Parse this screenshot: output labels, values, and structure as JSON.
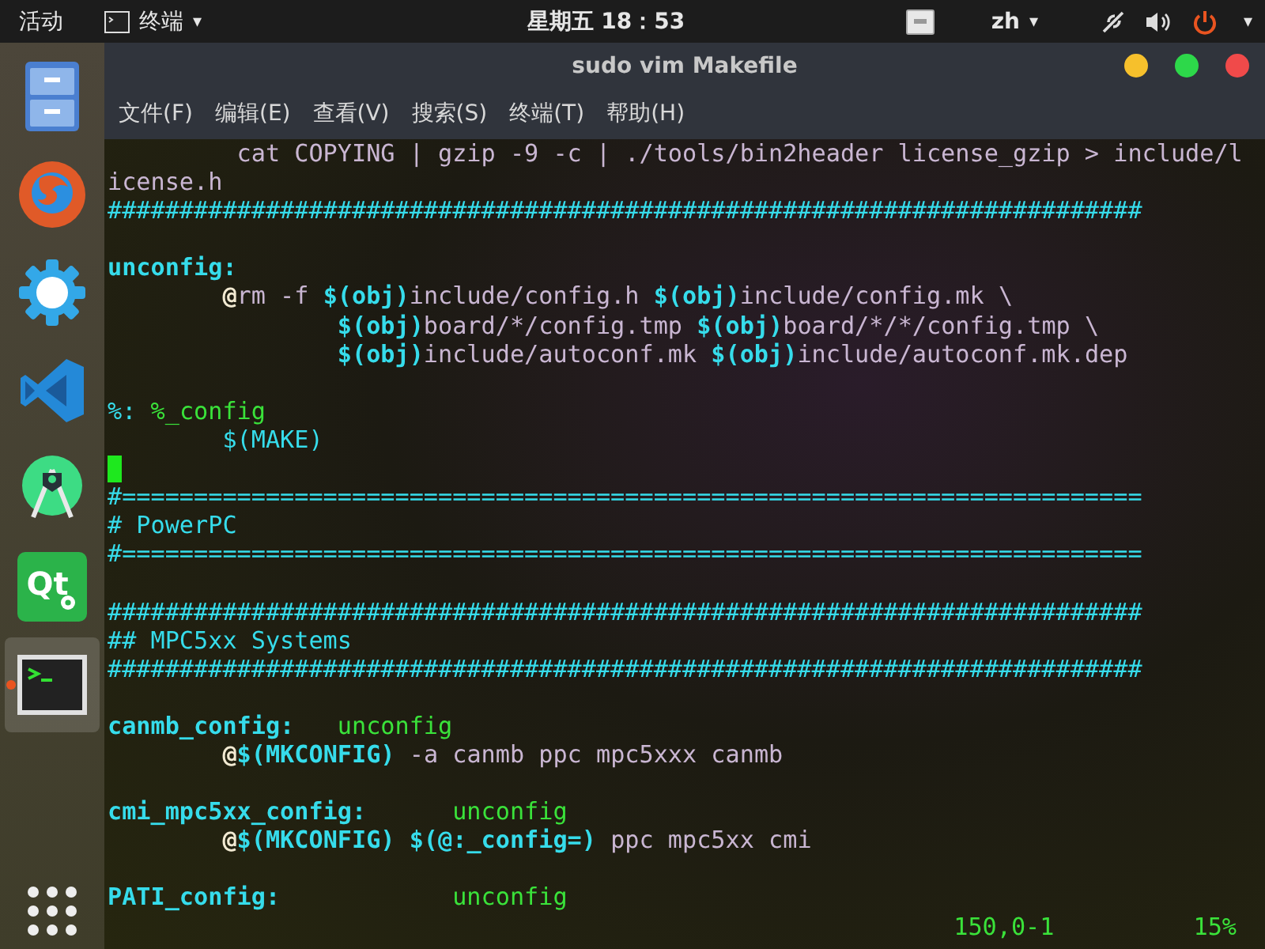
{
  "top_bar": {
    "activities": "活动",
    "app_menu": {
      "label": "终端",
      "caret": "▾"
    },
    "clock": "星期五 18：53",
    "input_method": {
      "label": "zh",
      "caret": "▾"
    },
    "system_caret": "▾"
  },
  "dock": {
    "items": [
      {
        "kind": "files",
        "selected": false,
        "running": false
      },
      {
        "kind": "browser",
        "selected": false,
        "running": false
      },
      {
        "kind": "settings",
        "selected": false,
        "running": false
      },
      {
        "kind": "editor",
        "selected": false,
        "running": false
      },
      {
        "kind": "studio",
        "selected": false,
        "running": false
      },
      {
        "kind": "qt",
        "logo": "Qt",
        "selected": false,
        "running": false
      },
      {
        "kind": "terminal",
        "selected": true,
        "running": true
      }
    ]
  },
  "window": {
    "title": "sudo vim Makefile",
    "menu": [
      "文件(F)",
      "编辑(E)",
      "查看(V)",
      "搜索(S)",
      "终端(T)",
      "帮助(H)"
    ]
  },
  "editor": {
    "lines": [
      {
        "kind": "code",
        "segments": [
          {
            "kind": "text",
            "text": "         cat COPYING | gzip -9 -c | ./tools/bin2header license_gzip > include/l"
          }
        ]
      },
      {
        "kind": "code",
        "segments": [
          {
            "kind": "text",
            "text": "icense.h"
          }
        ]
      },
      {
        "kind": "code",
        "segments": [
          {
            "kind": "comment",
            "text": "########################################################################"
          }
        ]
      },
      {
        "kind": "blank"
      },
      {
        "kind": "code",
        "segments": [
          {
            "kind": "target",
            "text": "unconfig:"
          }
        ]
      },
      {
        "kind": "code",
        "segments": [
          {
            "kind": "special",
            "text": "        @"
          },
          {
            "kind": "text",
            "text": "rm -f "
          },
          {
            "kind": "variable",
            "text": "$(obj)"
          },
          {
            "kind": "text",
            "text": "include/config.h "
          },
          {
            "kind": "variable",
            "text": "$(obj)"
          },
          {
            "kind": "text",
            "text": "include/config.mk \\"
          }
        ]
      },
      {
        "kind": "code",
        "segments": [
          {
            "kind": "variable",
            "text": "                $(obj)"
          },
          {
            "kind": "text",
            "text": "board/*/config.tmp "
          },
          {
            "kind": "variable",
            "text": "$(obj)"
          },
          {
            "kind": "text",
            "text": "board/*/*/config.tmp \\"
          }
        ]
      },
      {
        "kind": "code",
        "segments": [
          {
            "kind": "variable",
            "text": "                $(obj)"
          },
          {
            "kind": "text",
            "text": "include/autoconf.mk "
          },
          {
            "kind": "variable",
            "text": "$(obj)"
          },
          {
            "kind": "text",
            "text": "include/autoconf.mk.dep"
          }
        ]
      },
      {
        "kind": "blank"
      },
      {
        "kind": "code",
        "segments": [
          {
            "kind": "comment",
            "text": "%:"
          },
          {
            "kind": "green",
            "text": " %_config"
          }
        ]
      },
      {
        "kind": "code",
        "segments": [
          {
            "kind": "comment",
            "text": "        $(MAKE)"
          }
        ]
      },
      {
        "kind": "cursor"
      },
      {
        "kind": "code",
        "segments": [
          {
            "kind": "comment",
            "text": "#======================================================================="
          }
        ]
      },
      {
        "kind": "code",
        "segments": [
          {
            "kind": "comment",
            "text": "# PowerPC"
          }
        ]
      },
      {
        "kind": "code",
        "segments": [
          {
            "kind": "comment",
            "text": "#======================================================================="
          }
        ]
      },
      {
        "kind": "blank"
      },
      {
        "kind": "code",
        "segments": [
          {
            "kind": "comment",
            "text": "########################################################################"
          }
        ]
      },
      {
        "kind": "code",
        "segments": [
          {
            "kind": "comment",
            "text": "## MPC5xx Systems"
          }
        ]
      },
      {
        "kind": "code",
        "segments": [
          {
            "kind": "comment",
            "text": "########################################################################"
          }
        ]
      },
      {
        "kind": "blank"
      },
      {
        "kind": "code",
        "segments": [
          {
            "kind": "target",
            "text": "canmb_config:   "
          },
          {
            "kind": "green",
            "text": "unconfig"
          }
        ]
      },
      {
        "kind": "code",
        "segments": [
          {
            "kind": "special",
            "text": "        @"
          },
          {
            "kind": "variable",
            "text": "$(MKCONFIG)"
          },
          {
            "kind": "text",
            "text": " -a canmb ppc mpc5xxx canmb"
          }
        ]
      },
      {
        "kind": "blank"
      },
      {
        "kind": "code",
        "segments": [
          {
            "kind": "target",
            "text": "cmi_mpc5xx_config:      "
          },
          {
            "kind": "green",
            "text": "unconfig"
          }
        ]
      },
      {
        "kind": "code",
        "segments": [
          {
            "kind": "special",
            "text": "        @"
          },
          {
            "kind": "variable",
            "text": "$(MKCONFIG) $(@:_config=)"
          },
          {
            "kind": "text",
            "text": " ppc mpc5xx cmi"
          }
        ]
      },
      {
        "kind": "blank"
      },
      {
        "kind": "code",
        "segments": [
          {
            "kind": "target",
            "text": "PATI_config:            "
          },
          {
            "kind": "green",
            "text": "unconfig"
          }
        ]
      }
    ],
    "ruler": {
      "position": "150,0-1",
      "percent": "15%"
    }
  }
}
